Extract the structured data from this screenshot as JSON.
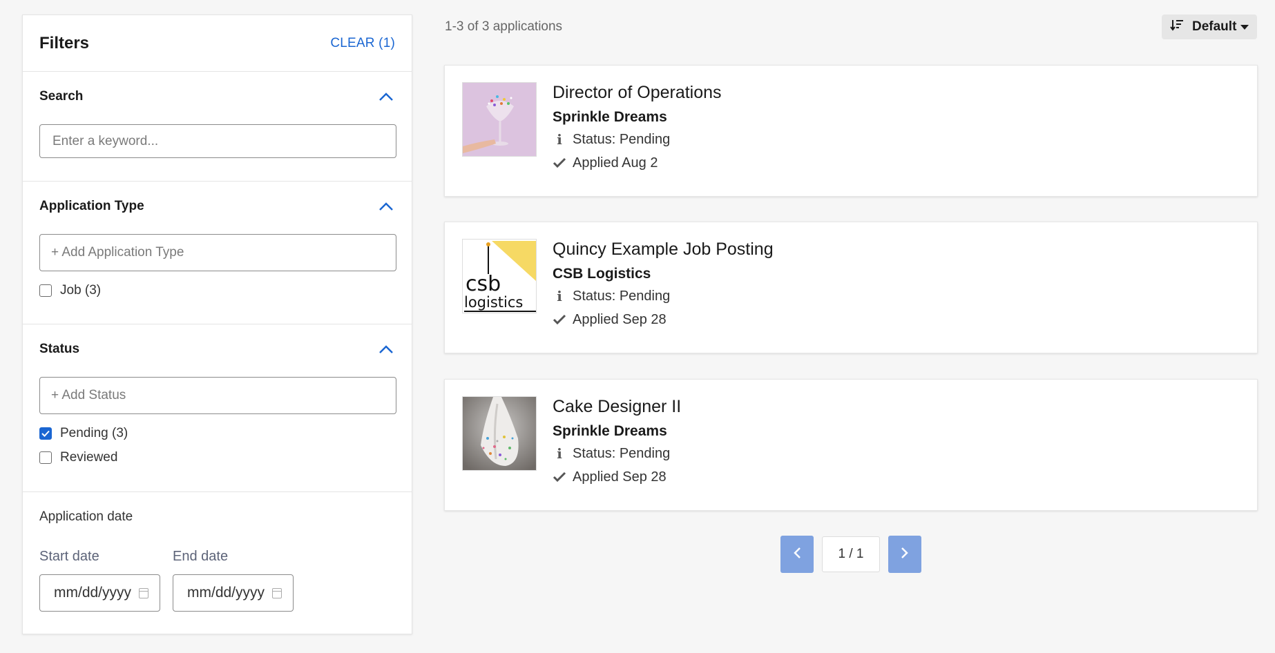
{
  "filters": {
    "title": "Filters",
    "clear_label": "CLEAR (1)",
    "search": {
      "title": "Search",
      "placeholder": "Enter a keyword..."
    },
    "application_type": {
      "title": "Application Type",
      "add_label": "+ Add Application Type",
      "options": [
        {
          "label": "Job (3)",
          "checked": false
        }
      ]
    },
    "status": {
      "title": "Status",
      "add_label": "+ Add Status",
      "options": [
        {
          "label": "Pending (3)",
          "checked": true
        },
        {
          "label": "Reviewed",
          "checked": false
        }
      ]
    },
    "application_date": {
      "title": "Application date",
      "start_label": "Start date",
      "end_label": "End date",
      "start_placeholder": "mm/dd/yyyy",
      "end_placeholder": "mm/dd/yyyy"
    }
  },
  "results": {
    "count_label": "1-3 of 3 applications",
    "sort_label": "Default"
  },
  "applications": [
    {
      "title": "Director of Operations",
      "company": "Sprinkle Dreams",
      "status": "Status: Pending",
      "applied": "Applied Aug 2"
    },
    {
      "title": "Quincy Example Job Posting",
      "company": "CSB Logistics",
      "status": "Status: Pending",
      "applied": "Applied Sep 28"
    },
    {
      "title": "Cake Designer II",
      "company": "Sprinkle Dreams",
      "status": "Status: Pending",
      "applied": "Applied Sep 28"
    }
  ],
  "logo_text": {
    "line1": "csb",
    "line2": "logistics"
  },
  "pagination": {
    "indicator": "1 / 1"
  },
  "colors": {
    "accent": "#1a66d2",
    "pager": "#7fa2e0",
    "background": "#f6f6f6"
  }
}
